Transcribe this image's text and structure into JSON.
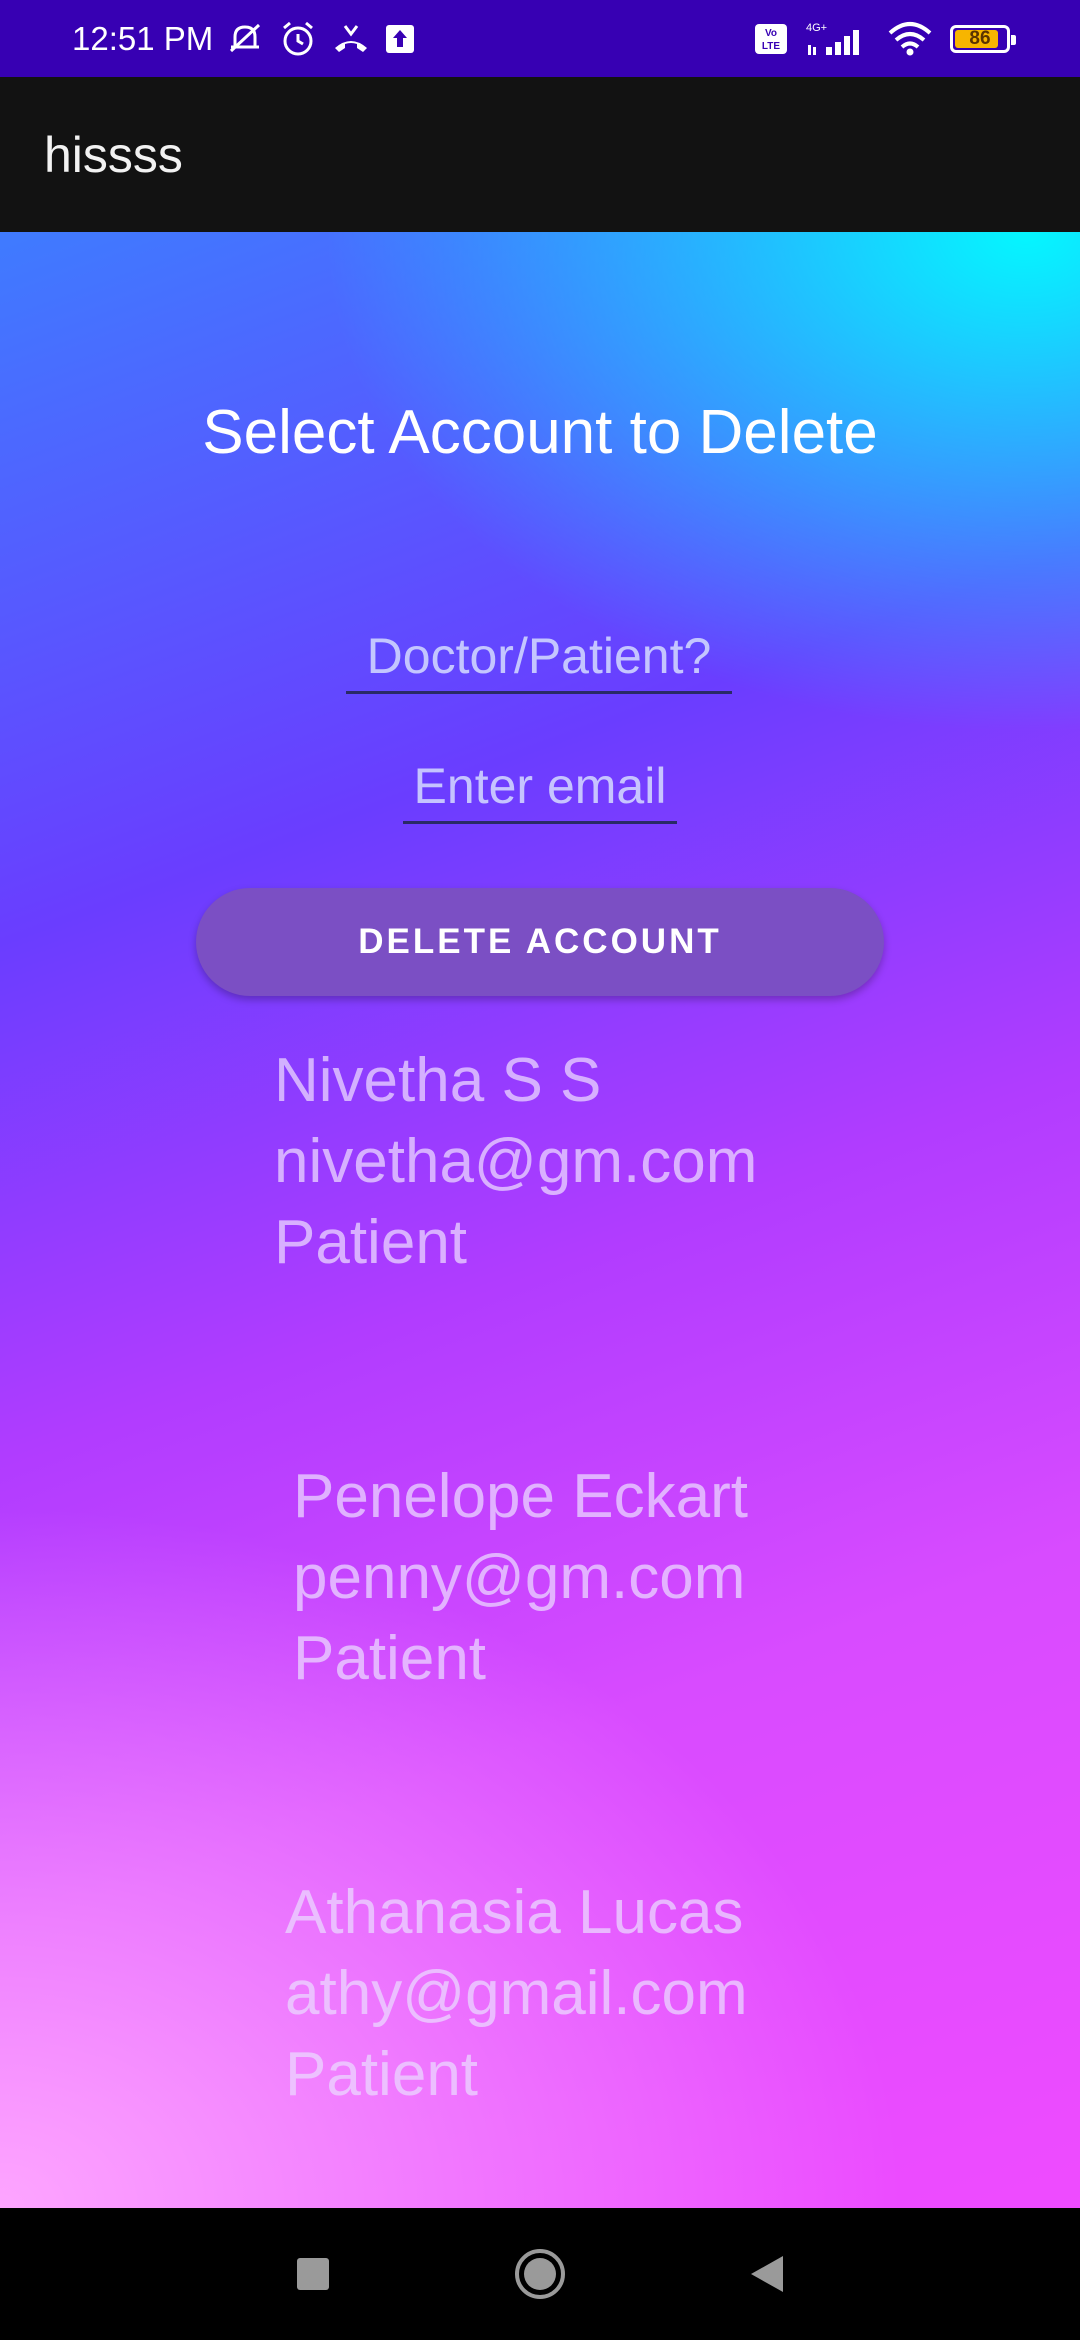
{
  "status_bar": {
    "time": "12:51 PM",
    "left_icons": [
      "muted-bell-icon",
      "alarm-icon",
      "call-forward-icon",
      "upload-icon"
    ],
    "right_icons": [
      "volte-icon",
      "signal-4g-icon",
      "wifi-icon",
      "battery-icon"
    ],
    "volte_label": "Vo LTE",
    "network_label": "4G+",
    "battery_level": "86",
    "battery_fraction": 0.86,
    "battery_color": "#f7b500"
  },
  "app_bar": {
    "title": "hissss",
    "background": "#121212"
  },
  "main": {
    "heading": "Select Account to Delete",
    "role_input": {
      "placeholder": "Doctor/Patient?",
      "value": ""
    },
    "email_input": {
      "placeholder": "Enter email",
      "value": ""
    },
    "delete_button_label": "DELETE ACCOUNT",
    "accounts": [
      {
        "name": "Nivetha S S",
        "email": "nivetha@gm.com",
        "role": "Patient"
      },
      {
        "name": "Penelope Eckart",
        "email": "penny@gm.com",
        "role": "Patient"
      },
      {
        "name": "Athanasia Lucas",
        "email": "athy@gmail.com",
        "role": "Patient"
      }
    ]
  },
  "nav_bar": {
    "icons": [
      "recents-square-icon",
      "home-circle-icon",
      "back-triangle-icon"
    ]
  },
  "colors": {
    "status_bar": "#3700b3",
    "button": "#7b4fc4",
    "gradient_top_right": "#00ffff",
    "gradient_bottom": "#ef4bff"
  }
}
